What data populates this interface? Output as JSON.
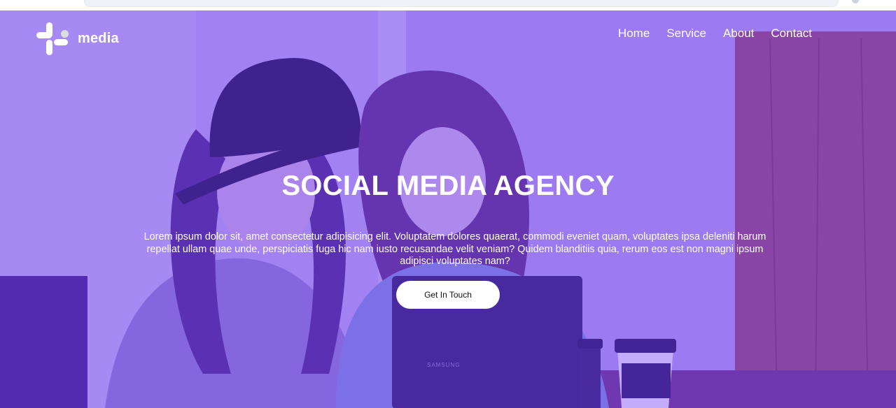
{
  "brand": {
    "name": "media",
    "logo_icon": "slack-like-hash-icon"
  },
  "nav": {
    "items": [
      {
        "label": "Home"
      },
      {
        "label": "Service"
      },
      {
        "label": "About"
      },
      {
        "label": "Contact"
      }
    ]
  },
  "hero": {
    "title": "SOCIAL MEDIA AGENCY",
    "description": "Lorem ipsum dolor sit, amet consectetur adipisicing elit. Voluptatem dolores quaerat, commodi eveniet quam, voluptates ipsa deleniti harum repellat ullam quae unde, perspiciatis fuga hic nam iusto recusandae velit veniam? Quidem blanditiis quia, rerum eos est non magni ipsum adipisci voluptates nam?",
    "cta_label": "Get In Touch",
    "overlay_color": "#7846f0",
    "laptop_brand": "SAMSUNG"
  }
}
